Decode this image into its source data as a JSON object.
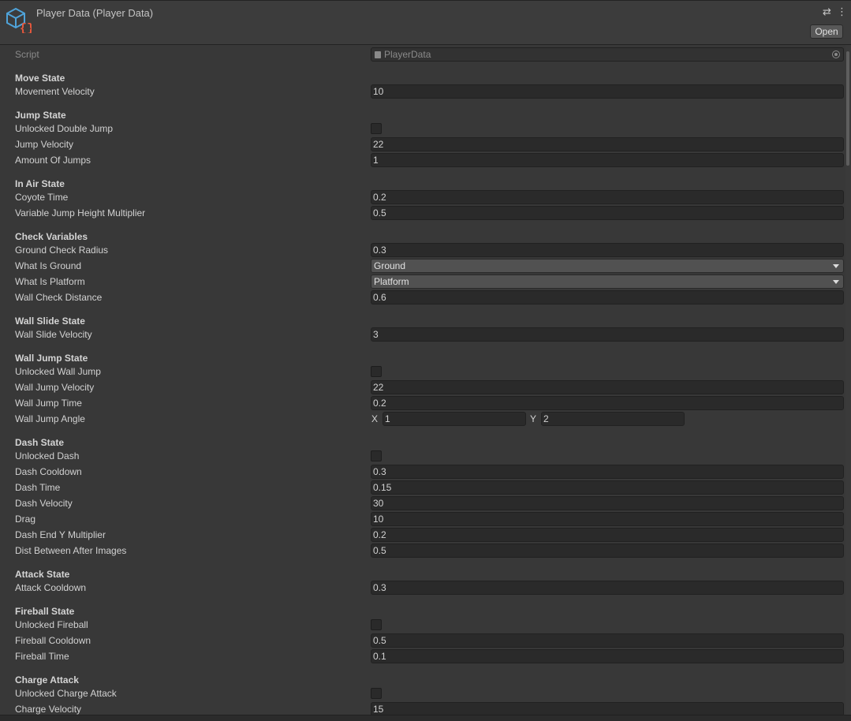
{
  "header": {
    "title": "Player Data (Player Data)",
    "open_label": "Open",
    "settings_glyph": "⇄",
    "menu_glyph": "⋮"
  },
  "script": {
    "label": "Script",
    "value": "PlayerData"
  },
  "sections": {
    "move_state": "Move State",
    "jump_state": "Jump State",
    "in_air_state": "In Air State",
    "check_variables": "Check Variables",
    "wall_slide_state": "Wall Slide State",
    "wall_jump_state": "Wall Jump State",
    "dash_state": "Dash State",
    "attack_state": "Attack State",
    "fireball_state": "Fireball State",
    "charge_attack": "Charge Attack"
  },
  "fields": {
    "movement_velocity": {
      "label": "Movement Velocity",
      "value": "10"
    },
    "unlocked_double_jump": {
      "label": "Unlocked Double Jump",
      "checked": false
    },
    "jump_velocity": {
      "label": "Jump Velocity",
      "value": "22"
    },
    "amount_of_jumps": {
      "label": "Amount Of Jumps",
      "value": "1"
    },
    "coyote_time": {
      "label": "Coyote Time",
      "value": "0.2"
    },
    "variable_jump_height_multiplier": {
      "label": "Variable Jump Height Multiplier",
      "value": "0.5"
    },
    "ground_check_radius": {
      "label": "Ground Check Radius",
      "value": "0.3"
    },
    "what_is_ground": {
      "label": "What Is Ground",
      "value": "Ground"
    },
    "what_is_platform": {
      "label": "What Is Platform",
      "value": "Platform"
    },
    "wall_check_distance": {
      "label": "Wall Check Distance",
      "value": "0.6"
    },
    "wall_slide_velocity": {
      "label": "Wall Slide Velocity",
      "value": "3"
    },
    "unlocked_wall_jump": {
      "label": "Unlocked Wall Jump",
      "checked": false
    },
    "wall_jump_velocity": {
      "label": "Wall Jump Velocity",
      "value": "22"
    },
    "wall_jump_time": {
      "label": "Wall Jump Time",
      "value": "0.2"
    },
    "wall_jump_angle": {
      "label": "Wall Jump Angle",
      "x_label": "X",
      "x": "1",
      "y_label": "Y",
      "y": "2"
    },
    "unlocked_dash": {
      "label": "Unlocked Dash",
      "checked": false
    },
    "dash_cooldown": {
      "label": "Dash Cooldown",
      "value": "0.3"
    },
    "dash_time": {
      "label": "Dash Time",
      "value": "0.15"
    },
    "dash_velocity": {
      "label": "Dash Velocity",
      "value": "30"
    },
    "drag": {
      "label": "Drag",
      "value": "10"
    },
    "dash_end_y_multiplier": {
      "label": "Dash End Y Multiplier",
      "value": "0.2"
    },
    "dist_between_after_images": {
      "label": "Dist Between After Images",
      "value": "0.5"
    },
    "attack_cooldown": {
      "label": "Attack Cooldown",
      "value": "0.3"
    },
    "unlocked_fireball": {
      "label": "Unlocked Fireball",
      "checked": false
    },
    "fireball_cooldown": {
      "label": "Fireball Cooldown",
      "value": "0.5"
    },
    "fireball_time": {
      "label": "Fireball Time",
      "value": "0.1"
    },
    "unlocked_charge_attack": {
      "label": "Unlocked Charge Attack",
      "checked": false
    },
    "charge_velocity": {
      "label": "Charge Velocity",
      "value": "15"
    }
  },
  "colors": {
    "background": "#383838",
    "field": "#2a2a2a",
    "dropdown": "#515151",
    "icon_accent": "#e8583c",
    "icon_cube": "#4fa3d9"
  },
  "icons": {
    "asset": "scriptable-object-icon",
    "script": "script-file-icon",
    "target": "object-picker-icon"
  }
}
